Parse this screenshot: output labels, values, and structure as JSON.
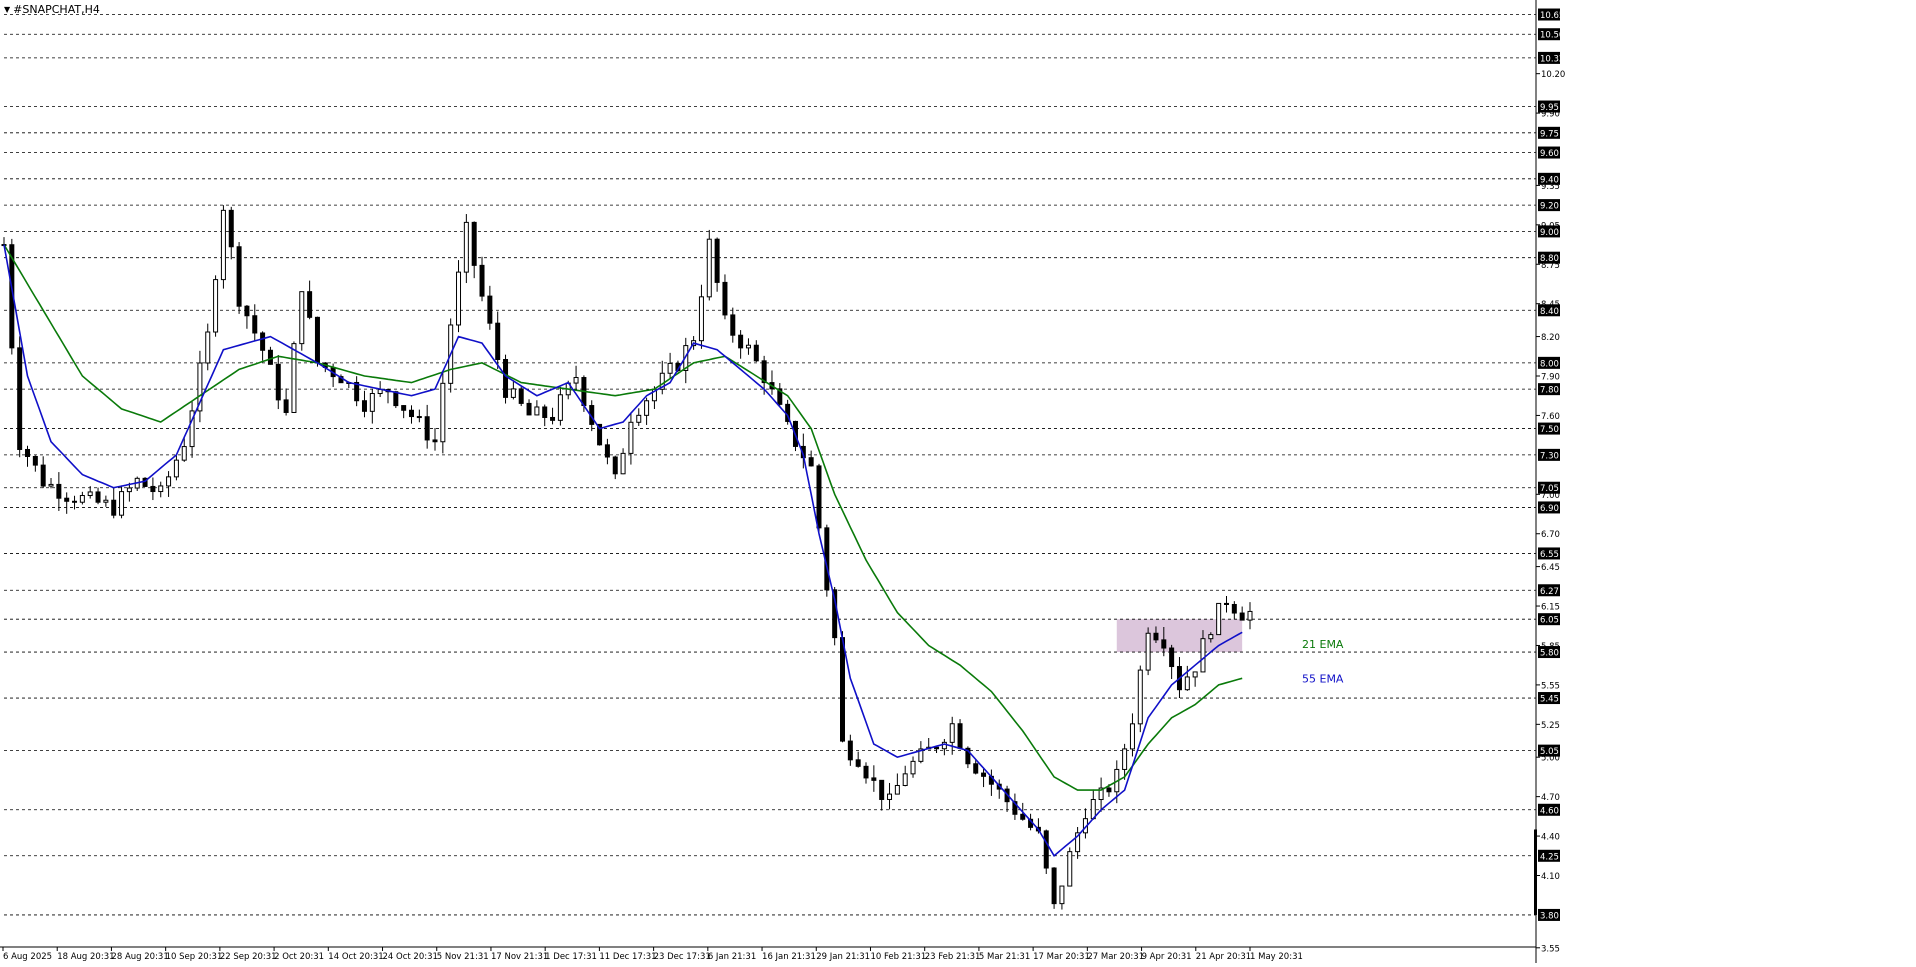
{
  "window": {
    "symbol_label": "#SNAPCHAT,H4"
  },
  "chart_data": {
    "type": "candlestick",
    "symbol": "#SNAPCHAT",
    "timeframe": "H4",
    "ylim": [
      3.5,
      10.7
    ],
    "grid": "horizontal dashed at level lines",
    "level_lines": [
      10.65,
      10.5,
      10.32,
      9.95,
      9.75,
      9.6,
      9.4,
      9.2,
      9.0,
      8.8,
      8.4,
      8.0,
      7.8,
      7.5,
      7.3,
      7.05,
      6.9,
      6.55,
      6.27,
      6.05,
      5.8,
      5.45,
      5.05,
      4.6,
      4.25,
      3.8
    ],
    "level_labels": [
      "10.65",
      "10.50",
      "10.32",
      "9.95",
      "9.75",
      "9.60",
      "9.40",
      "9.20",
      "9.00",
      "8.80",
      "8.40",
      "8.00",
      "7.80",
      "7.50",
      "7.30",
      "7.05",
      "6.90",
      "6.55",
      "6.27",
      "6.05",
      "5.80",
      "5.45",
      "5.05",
      "4.60",
      "4.25",
      "3.80"
    ],
    "axis_ticks": [
      10.2,
      9.9,
      9.35,
      9.05,
      8.75,
      8.45,
      8.2,
      7.9,
      7.6,
      7.0,
      6.7,
      6.45,
      6.15,
      5.85,
      5.55,
      5.25,
      5.0,
      4.7,
      4.4,
      4.1,
      3.55
    ],
    "axis_tick_labels": [
      "10.20",
      "9.90",
      "9.35",
      "9.05",
      "8.75",
      "8.45",
      "8.20",
      "7.90",
      "7.60",
      "7.00",
      "6.70",
      "6.45",
      "6.15",
      "5.85",
      "5.55",
      "5.25",
      "5.00",
      "4.70",
      "4.40",
      "4.10",
      "3.55"
    ],
    "x_labels": [
      "6 Aug 2025",
      "18 Aug 20:31",
      "28 Aug 20:31",
      "10 Sep 20:31",
      "22 Sep 20:31",
      "2 Oct 20:31",
      "14 Oct 20:31",
      "24 Oct 20:31",
      "5 Nov 21:31",
      "17 Nov 21:31",
      "1 Dec 17:31",
      "11 Dec 17:31",
      "23 Dec 17:31",
      "6 Jan 21:31",
      "16 Jan 21:31",
      "29 Jan 21:31",
      "10 Feb 21:31",
      "23 Feb 21:31",
      "5 Mar 21:31",
      "17 Mar 20:31",
      "27 Mar 20:31",
      "9 Apr 20:31",
      "21 Apr 20:31",
      "1 May 20:31"
    ],
    "price_path": [
      [
        0,
        8.9
      ],
      [
        2,
        7.4
      ],
      [
        5,
        7.1
      ],
      [
        8,
        7.0
      ],
      [
        11,
        6.95
      ],
      [
        14,
        6.9
      ],
      [
        17,
        7.1
      ],
      [
        20,
        7.0
      ],
      [
        23,
        7.4
      ],
      [
        26,
        8.2
      ],
      [
        28,
        9.2
      ],
      [
        30,
        8.5
      ],
      [
        33,
        8.1
      ],
      [
        36,
        7.6
      ],
      [
        38,
        8.6
      ],
      [
        40,
        8.0
      ],
      [
        43,
        7.9
      ],
      [
        46,
        7.7
      ],
      [
        49,
        7.8
      ],
      [
        52,
        7.6
      ],
      [
        55,
        7.4
      ],
      [
        57,
        8.3
      ],
      [
        59,
        9.0
      ],
      [
        61,
        8.5
      ],
      [
        64,
        7.8
      ],
      [
        67,
        7.6
      ],
      [
        70,
        7.6
      ],
      [
        73,
        7.9
      ],
      [
        76,
        7.4
      ],
      [
        78,
        7.1
      ],
      [
        80,
        7.6
      ],
      [
        83,
        7.8
      ],
      [
        86,
        8.0
      ],
      [
        88,
        8.2
      ],
      [
        90,
        8.9
      ],
      [
        92,
        8.3
      ],
      [
        95,
        8.1
      ],
      [
        97,
        7.9
      ],
      [
        100,
        7.5
      ],
      [
        103,
        7.2
      ],
      [
        105,
        6.3
      ],
      [
        106,
        5.9
      ],
      [
        107,
        5.1
      ],
      [
        109,
        5.0
      ],
      [
        111,
        4.8
      ],
      [
        113,
        4.65
      ],
      [
        115,
        4.9
      ],
      [
        117,
        5.0
      ],
      [
        119,
        5.1
      ],
      [
        121,
        5.25
      ],
      [
        123,
        5.0
      ],
      [
        126,
        4.8
      ],
      [
        129,
        4.6
      ],
      [
        132,
        4.4
      ],
      [
        134,
        3.85
      ],
      [
        136,
        4.25
      ],
      [
        138,
        4.6
      ],
      [
        140,
        4.7
      ],
      [
        142,
        4.85
      ],
      [
        144,
        5.3
      ],
      [
        146,
        6.0
      ],
      [
        148,
        5.9
      ],
      [
        150,
        5.55
      ],
      [
        152,
        5.7
      ],
      [
        154,
        6.0
      ],
      [
        156,
        6.2
      ],
      [
        158,
        6.1
      ]
    ],
    "ema_fast_path": [
      [
        0,
        8.9
      ],
      [
        3,
        7.9
      ],
      [
        6,
        7.4
      ],
      [
        10,
        7.15
      ],
      [
        14,
        7.05
      ],
      [
        18,
        7.1
      ],
      [
        22,
        7.3
      ],
      [
        25,
        7.7
      ],
      [
        28,
        8.1
      ],
      [
        31,
        8.15
      ],
      [
        34,
        8.2
      ],
      [
        37,
        8.1
      ],
      [
        40,
        8.0
      ],
      [
        44,
        7.85
      ],
      [
        48,
        7.8
      ],
      [
        52,
        7.75
      ],
      [
        55,
        7.8
      ],
      [
        58,
        8.2
      ],
      [
        61,
        8.15
      ],
      [
        64,
        7.9
      ],
      [
        68,
        7.75
      ],
      [
        72,
        7.85
      ],
      [
        76,
        7.5
      ],
      [
        79,
        7.55
      ],
      [
        82,
        7.75
      ],
      [
        85,
        7.85
      ],
      [
        88,
        8.15
      ],
      [
        91,
        8.1
      ],
      [
        94,
        7.95
      ],
      [
        97,
        7.8
      ],
      [
        100,
        7.6
      ],
      [
        102,
        7.3
      ],
      [
        104,
        6.7
      ],
      [
        106,
        6.2
      ],
      [
        108,
        5.6
      ],
      [
        111,
        5.1
      ],
      [
        114,
        5.0
      ],
      [
        117,
        5.05
      ],
      [
        120,
        5.1
      ],
      [
        123,
        5.05
      ],
      [
        126,
        4.85
      ],
      [
        129,
        4.65
      ],
      [
        132,
        4.45
      ],
      [
        134,
        4.25
      ],
      [
        137,
        4.4
      ],
      [
        140,
        4.6
      ],
      [
        143,
        4.75
      ],
      [
        146,
        5.3
      ],
      [
        149,
        5.55
      ],
      [
        152,
        5.7
      ],
      [
        155,
        5.85
      ],
      [
        158,
        5.95
      ]
    ],
    "ema_slow_path": [
      [
        0,
        8.9
      ],
      [
        5,
        8.4
      ],
      [
        10,
        7.9
      ],
      [
        15,
        7.65
      ],
      [
        20,
        7.55
      ],
      [
        25,
        7.75
      ],
      [
        30,
        7.95
      ],
      [
        35,
        8.05
      ],
      [
        40,
        8.0
      ],
      [
        46,
        7.9
      ],
      [
        52,
        7.85
      ],
      [
        57,
        7.95
      ],
      [
        61,
        8.0
      ],
      [
        66,
        7.85
      ],
      [
        72,
        7.8
      ],
      [
        78,
        7.75
      ],
      [
        83,
        7.8
      ],
      [
        88,
        8.0
      ],
      [
        92,
        8.05
      ],
      [
        96,
        7.9
      ],
      [
        100,
        7.75
      ],
      [
        103,
        7.5
      ],
      [
        106,
        7.0
      ],
      [
        110,
        6.5
      ],
      [
        114,
        6.1
      ],
      [
        118,
        5.85
      ],
      [
        122,
        5.7
      ],
      [
        126,
        5.5
      ],
      [
        130,
        5.2
      ],
      [
        134,
        4.85
      ],
      [
        137,
        4.75
      ],
      [
        140,
        4.75
      ],
      [
        143,
        4.85
      ],
      [
        146,
        5.1
      ],
      [
        149,
        5.3
      ],
      [
        152,
        5.4
      ],
      [
        155,
        5.55
      ],
      [
        158,
        5.6
      ]
    ],
    "series": [
      {
        "name": "21 EMA",
        "color": "#1010c8"
      },
      {
        "name": "55 EMA",
        "color": "#0a7a0a"
      }
    ],
    "legend_labels": [
      {
        "text": "21 EMA",
        "color": "#0a7a0a"
      },
      {
        "text": "55 EMA",
        "color": "#1010c8"
      }
    ],
    "zone": {
      "from_index": 142,
      "to_index": 158,
      "low": 5.8,
      "high": 6.05,
      "color": "#dcc6dc"
    },
    "colors": {
      "candle": "#000000",
      "grid": "#000000",
      "axis_text": "#000000",
      "label_box": "#000000",
      "label_text": "#ffffff"
    }
  }
}
